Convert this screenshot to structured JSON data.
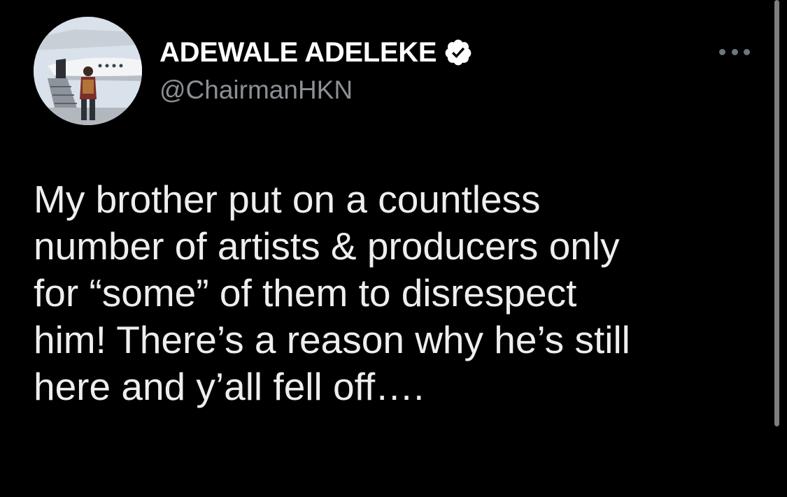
{
  "author": {
    "display_name": "ADEWALE ADELEKE",
    "handle": "@ChairmanHKN",
    "verified": true,
    "avatar_icon": "profile-photo-private-jet"
  },
  "tweet": {
    "lines": [
      "My brother put on a countless",
      "number of artists & producers only",
      "for “some” of them to disrespect",
      "him! There’s a reason why he’s still",
      "here and y’all fell off…."
    ]
  },
  "icons": {
    "more": "more-options-icon",
    "verified": "verified-badge-icon"
  },
  "colors": {
    "background": "#000000",
    "text_primary": "#e7e9ea",
    "text_secondary": "#8b9096",
    "verified_badge": "#ffffff"
  }
}
